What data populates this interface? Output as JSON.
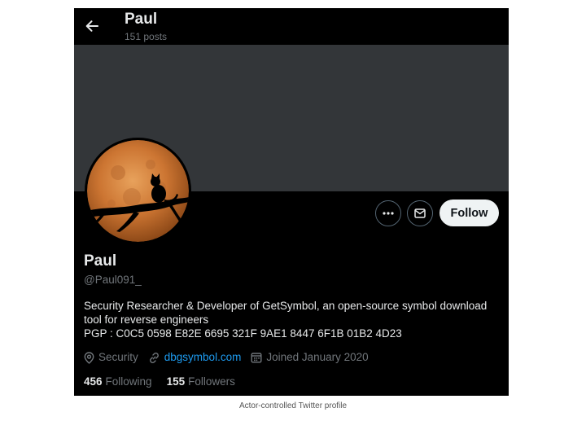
{
  "header": {
    "name": "Paul",
    "posts": "151 posts"
  },
  "profile": {
    "display_name": "Paul",
    "handle": "@Paul091_",
    "bio_lines": [
      "Security Researcher & Developer of GetSymbol, an open-source symbol download",
      "tool for reverse engineers",
      "PGP : C0C5 0598 E82E 6695 321F 9AE1 8447 6F1B 01B2 4D23"
    ],
    "location": "Security",
    "website": "dbgsymbol.com",
    "joined": "Joined January 2020",
    "following_count": "456",
    "following_label": "Following",
    "followers_count": "155",
    "followers_label": "Followers"
  },
  "actions": {
    "follow_label": "Follow"
  },
  "icons": {
    "back": "arrow-left-icon",
    "more": "more-horizontal-icon",
    "message": "envelope-icon",
    "location": "location-pin-icon",
    "link": "link-icon",
    "calendar": "calendar-icon"
  },
  "colors": {
    "background": "#000000",
    "banner": "#333639",
    "text_primary": "#e7e9ea",
    "text_secondary": "#71767b",
    "link": "#1d9bf0",
    "follow_button": "#eff3f4"
  },
  "caption": "Actor-controlled Twitter profile"
}
